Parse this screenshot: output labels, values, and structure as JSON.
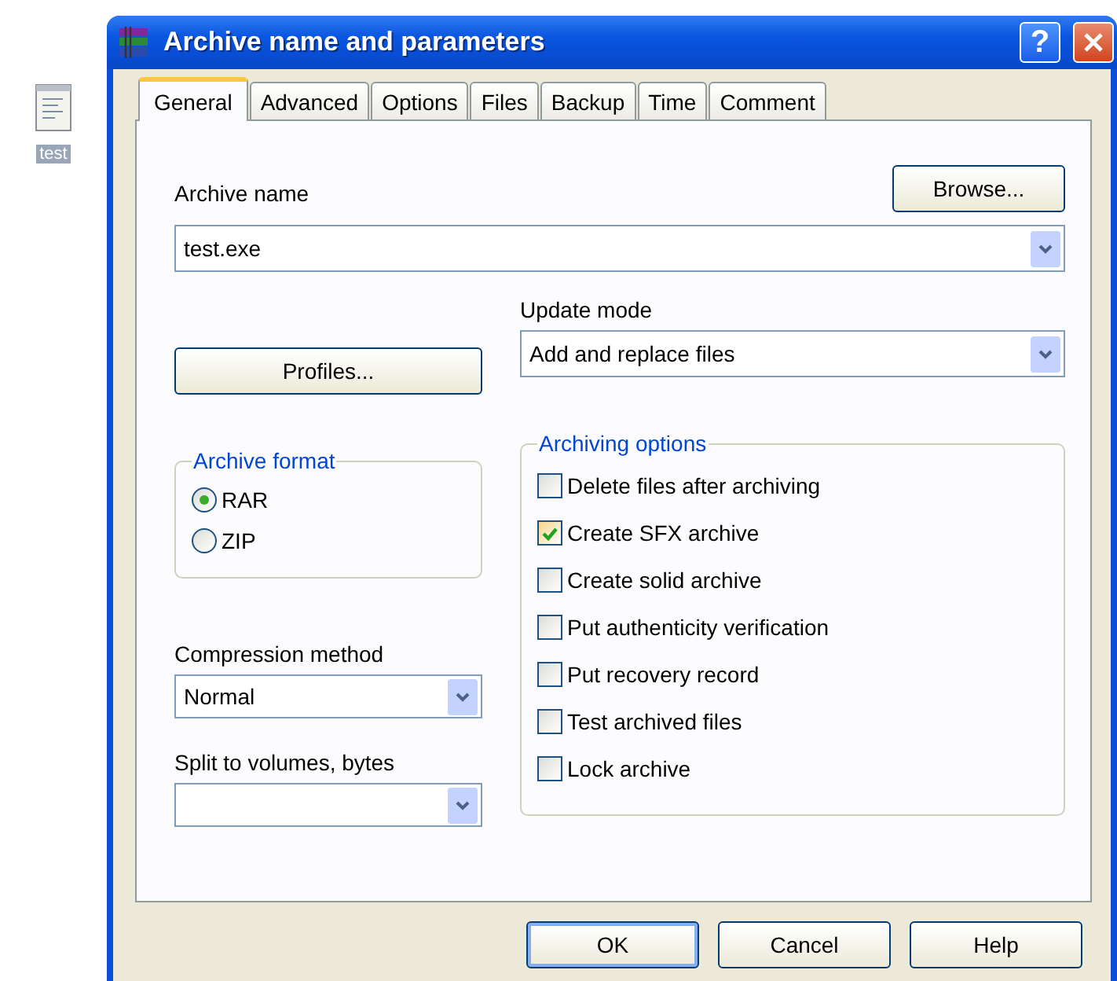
{
  "desktop_icon": {
    "label": "test"
  },
  "window": {
    "title": "Archive name and parameters",
    "help_glyph": "?"
  },
  "tabs": [
    {
      "label": "General",
      "selected": true
    },
    {
      "label": "Advanced",
      "selected": false
    },
    {
      "label": "Options",
      "selected": false
    },
    {
      "label": "Files",
      "selected": false
    },
    {
      "label": "Backup",
      "selected": false
    },
    {
      "label": "Time",
      "selected": false
    },
    {
      "label": "Comment",
      "selected": false
    }
  ],
  "archive_name": {
    "label": "Archive name",
    "value": "test.exe"
  },
  "browse_button": "Browse...",
  "profiles_button": "Profiles...",
  "update_mode": {
    "label": "Update mode",
    "value": "Add and replace files"
  },
  "archive_format": {
    "title": "Archive format",
    "options": [
      {
        "label": "RAR",
        "selected": true
      },
      {
        "label": "ZIP",
        "selected": false
      }
    ]
  },
  "compression_method": {
    "label": "Compression method",
    "value": "Normal"
  },
  "split_volumes": {
    "label": "Split to volumes, bytes"
  },
  "archiving_options": {
    "title": "Archiving options",
    "options": [
      {
        "label": "Delete files after archiving",
        "checked": false
      },
      {
        "label": "Create SFX archive",
        "checked": true
      },
      {
        "label": "Create solid archive",
        "checked": false
      },
      {
        "label": "Put authenticity verification",
        "checked": false
      },
      {
        "label": "Put recovery record",
        "checked": false
      },
      {
        "label": "Test archived files",
        "checked": false
      },
      {
        "label": "Lock archive",
        "checked": false
      }
    ]
  },
  "buttons": [
    {
      "label": "OK",
      "default": true
    },
    {
      "label": "Cancel",
      "default": false
    },
    {
      "label": "Help",
      "default": false
    }
  ]
}
